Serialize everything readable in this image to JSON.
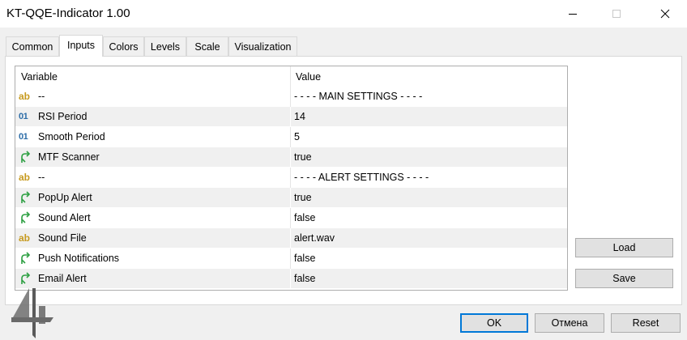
{
  "window": {
    "title": "KT-QQE-Indicator 1.00",
    "controls": [
      "minimize-icon",
      "maximize-icon",
      "close-icon"
    ]
  },
  "tabs": [
    {
      "label": "Common",
      "active": false
    },
    {
      "label": "Inputs",
      "active": true
    },
    {
      "label": "Colors",
      "active": false
    },
    {
      "label": "Levels",
      "active": false
    },
    {
      "label": "Scale",
      "active": false
    },
    {
      "label": "Visualization",
      "active": false
    }
  ],
  "grid": {
    "headers": {
      "variable": "Variable",
      "value": "Value"
    },
    "rows": [
      {
        "icon": "ab",
        "variable": "--",
        "value": "- - - - MAIN SETTINGS - - - -"
      },
      {
        "icon": "01",
        "variable": "RSI Period",
        "value": "14"
      },
      {
        "icon": "01",
        "variable": "Smooth Period",
        "value": "5"
      },
      {
        "icon": "arrow",
        "variable": "MTF Scanner",
        "value": "true"
      },
      {
        "icon": "ab",
        "variable": "--",
        "value": "- - - - ALERT SETTINGS - - - -"
      },
      {
        "icon": "arrow",
        "variable": "PopUp Alert",
        "value": "true"
      },
      {
        "icon": "arrow",
        "variable": "Sound Alert",
        "value": "false"
      },
      {
        "icon": "ab",
        "variable": "Sound File",
        "value": "alert.wav"
      },
      {
        "icon": "arrow",
        "variable": "Push Notifications",
        "value": "false"
      },
      {
        "icon": "arrow",
        "variable": "Email Alert",
        "value": "false"
      }
    ]
  },
  "buttons": {
    "load": "Load",
    "save": "Save",
    "ok": "OK",
    "cancel": "Отмена",
    "reset": "Reset"
  },
  "icon_text": {
    "ab": "ab",
    "int": "01"
  },
  "colors": {
    "string_icon": "#c79a1e",
    "int_icon": "#2e6ea8",
    "bool_icon": "#2ea043",
    "accent": "#0078d7"
  }
}
